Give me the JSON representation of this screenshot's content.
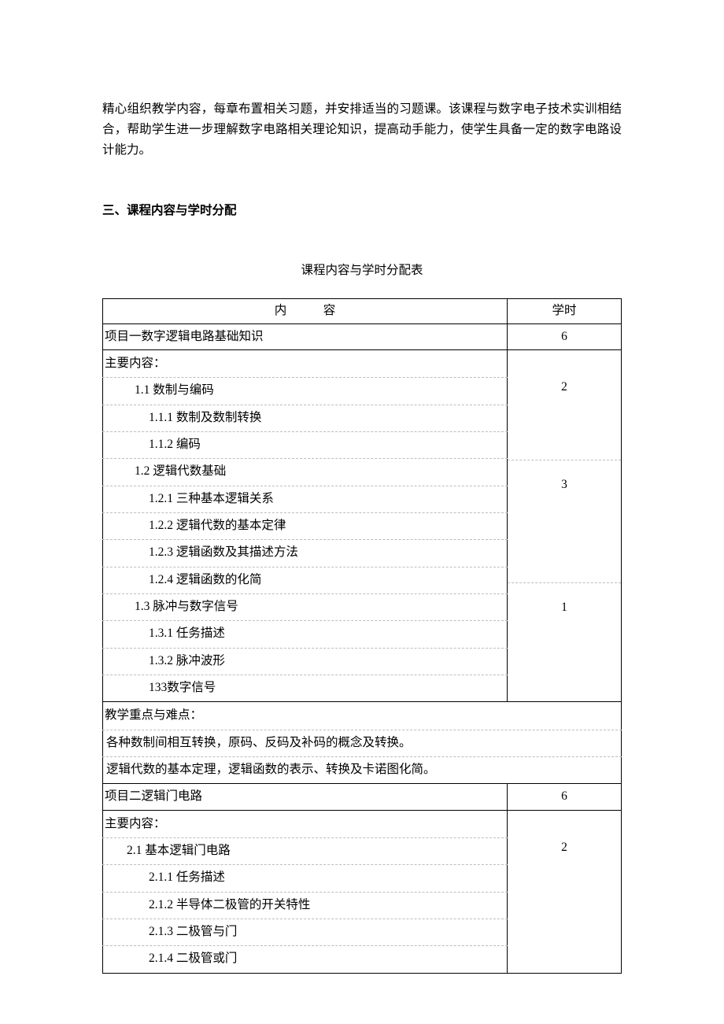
{
  "intro": "精心组织教学内容，每章布置相关习题，并安排适当的习题课。该课程与数字电子技术实训相结合，帮助学生进一步理解数字电路相关理论知识，提高动手能力，使学生具备一定的数字电路设计能力。",
  "section_heading": "三、课程内容与学时分配",
  "table_caption": "课程内容与学时分配表",
  "header": {
    "content_left": "内",
    "content_right": "容",
    "hours": "学时"
  },
  "chart_data": {
    "type": "table",
    "columns": [
      "内    容",
      "学时"
    ],
    "rows": [
      {
        "content": "项目一数字逻辑电路基础知识",
        "hours": 6,
        "indent": 0
      },
      {
        "content": "主要内容：",
        "hours": null,
        "indent": 0
      },
      {
        "content": "1.1 数制与编码",
        "hours": 2,
        "indent": 1
      },
      {
        "content": "1.1.1 数制及数制转换",
        "hours": null,
        "indent": 2
      },
      {
        "content": "1.1.2 编码",
        "hours": null,
        "indent": 2
      },
      {
        "content": "1.2 逻辑代数基础",
        "hours": 3,
        "indent": 1
      },
      {
        "content": "1.2.1 三种基本逻辑关系",
        "hours": null,
        "indent": 2
      },
      {
        "content": "1.2.2 逻辑代数的基本定律",
        "hours": null,
        "indent": 2
      },
      {
        "content": "1.2.3 逻辑函数及其描述方法",
        "hours": null,
        "indent": 2
      },
      {
        "content": "1.2.4 逻辑函数的化简",
        "hours": null,
        "indent": 2
      },
      {
        "content": "1.3 脉冲与数字信号",
        "hours": 1,
        "indent": 1
      },
      {
        "content": "1.3.1 任务描述",
        "hours": null,
        "indent": 2
      },
      {
        "content": "1.3.2 脉冲波形",
        "hours": null,
        "indent": 2
      },
      {
        "content": "133数字信号",
        "hours": null,
        "indent": 2
      },
      {
        "content": "教学重点与难点：",
        "hours": null,
        "indent": 0
      },
      {
        "content": "各种数制间相互转换，原码、反码及补码的概念及转换。",
        "hours": null,
        "indent": 1
      },
      {
        "content": "逻辑代数的基本定理，逻辑函数的表示、转换及卡诺图化简。",
        "hours": null,
        "indent": 1
      },
      {
        "content": "项目二逻辑门电路",
        "hours": 6,
        "indent": 0
      },
      {
        "content": "主要内容：",
        "hours": null,
        "indent": 0
      },
      {
        "content": "2.1  基本逻辑门电路",
        "hours": 2,
        "indent": 1
      },
      {
        "content": "2.1.1  任务描述",
        "hours": null,
        "indent": 2
      },
      {
        "content": "2.1.2  半导体二极管的开关特性",
        "hours": null,
        "indent": 2
      },
      {
        "content": "2.1.3  二极管与门",
        "hours": null,
        "indent": 2
      },
      {
        "content": "2.1.4  二极管或门",
        "hours": null,
        "indent": 2
      }
    ]
  },
  "body": {
    "row_project1": "项目一数字逻辑电路基础知识",
    "row_project1_hours": "6",
    "row_main1": "主要内容：",
    "row_1_1": "1.1 数制与编码",
    "row_1_1_h": "2",
    "row_1_1_1": "1.1.1 数制及数制转换",
    "row_1_1_2": "1.1.2 编码",
    "row_1_2": "1.2 逻辑代数基础",
    "row_1_2_h": "3",
    "row_1_2_1": "1.2.1 三种基本逻辑关系",
    "row_1_2_2": "1.2.2 逻辑代数的基本定律",
    "row_1_2_3": "1.2.3 逻辑函数及其描述方法",
    "row_1_2_4": "1.2.4 逻辑函数的化简",
    "row_1_3": "1.3 脉冲与数字信号",
    "row_1_3_h": "1",
    "row_1_3_1": "1.3.1 任务描述",
    "row_1_3_2": "1.3.2 脉冲波形",
    "row_1_3_3": "133数字信号",
    "row_key_heading": "教学重点与难点：",
    "row_key_1": "各种数制间相互转换，原码、反码及补码的概念及转换。",
    "row_key_2": "逻辑代数的基本定理，逻辑函数的表示、转换及卡诺图化简。",
    "row_project2": "项目二逻辑门电路",
    "row_project2_hours": "6",
    "row_main2": "主要内容：",
    "row_2_1": "2.1  基本逻辑门电路",
    "row_2_1_h": "2",
    "row_2_1_1": "2.1.1  任务描述",
    "row_2_1_2": "2.1.2  半导体二极管的开关特性",
    "row_2_1_3": "2.1.3  二极管与门",
    "row_2_1_4": "2.1.4  二极管或门"
  }
}
